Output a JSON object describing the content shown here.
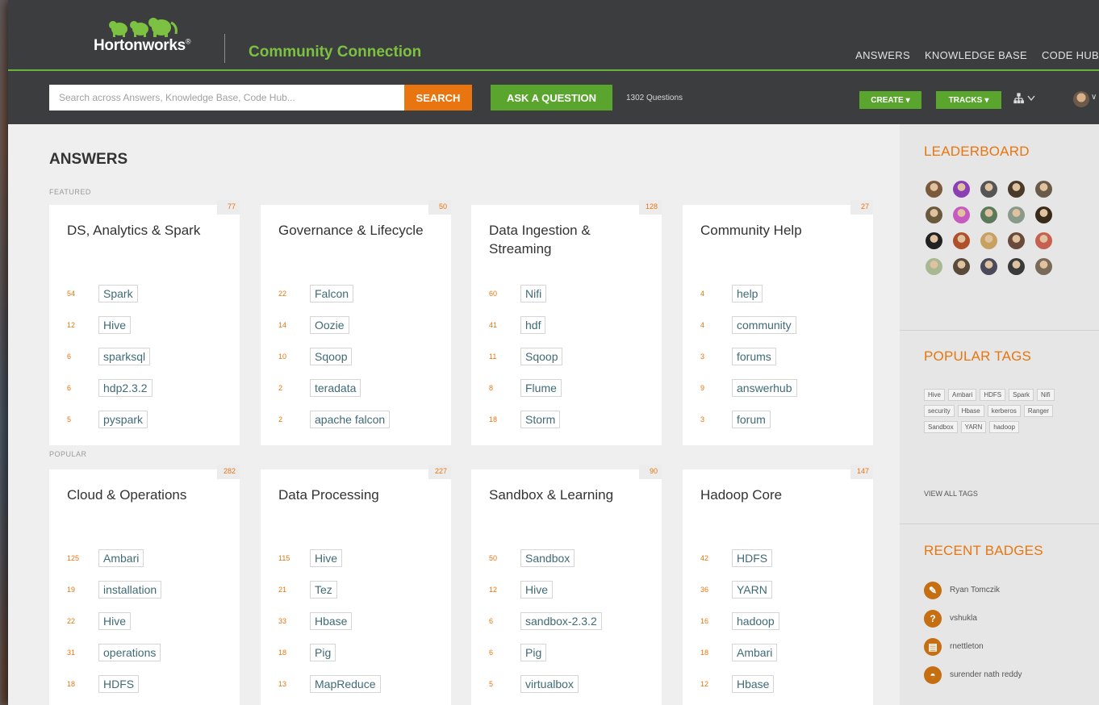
{
  "header": {
    "logo_text": "Hortonworks",
    "logo_reg": "®",
    "site_name": "Community Connection",
    "nav": [
      "ANSWERS",
      "KNOWLEDGE BASE",
      "CODE HUB"
    ]
  },
  "toolbar": {
    "search_placeholder": "Search across Answers, Knowledge Base, Code Hub...",
    "search_label": "SEARCH",
    "ask_label": "ASK A QUESTION",
    "question_count": "1302 Questions",
    "create_label": "CREATE",
    "tracks_label": "TRACKS"
  },
  "main": {
    "title": "ANSWERS",
    "featured_label": "FEATURED",
    "popular_label": "POPULAR",
    "featured": [
      {
        "title": "DS, Analytics & Spark",
        "count": "77",
        "tags": [
          {
            "num": "54",
            "name": "Spark"
          },
          {
            "num": "12",
            "name": "Hive"
          },
          {
            "num": "6",
            "name": "sparksql"
          },
          {
            "num": "6",
            "name": "hdp2.3.2"
          },
          {
            "num": "5",
            "name": "pyspark"
          }
        ]
      },
      {
        "title": "Governance & Lifecycle",
        "count": "50",
        "tags": [
          {
            "num": "22",
            "name": "Falcon"
          },
          {
            "num": "14",
            "name": "Oozie"
          },
          {
            "num": "10",
            "name": "Sqoop"
          },
          {
            "num": "2",
            "name": "teradata"
          },
          {
            "num": "2",
            "name": "apache falcon"
          }
        ]
      },
      {
        "title": "Data Ingestion & Streaming",
        "count": "128",
        "tags": [
          {
            "num": "60",
            "name": "Nifi"
          },
          {
            "num": "41",
            "name": "hdf"
          },
          {
            "num": "11",
            "name": "Sqoop"
          },
          {
            "num": "8",
            "name": "Flume"
          },
          {
            "num": "18",
            "name": "Storm"
          }
        ]
      },
      {
        "title": "Community Help",
        "count": "27",
        "tags": [
          {
            "num": "4",
            "name": "help"
          },
          {
            "num": "4",
            "name": "community"
          },
          {
            "num": "3",
            "name": "forums"
          },
          {
            "num": "9",
            "name": "answerhub"
          },
          {
            "num": "3",
            "name": "forum"
          }
        ]
      }
    ],
    "popular": [
      {
        "title": "Cloud & Operations",
        "count": "282",
        "tags": [
          {
            "num": "125",
            "name": "Ambari"
          },
          {
            "num": "19",
            "name": "installation"
          },
          {
            "num": "22",
            "name": "Hive"
          },
          {
            "num": "31",
            "name": "operations"
          },
          {
            "num": "18",
            "name": "HDFS"
          }
        ]
      },
      {
        "title": "Data Processing",
        "count": "227",
        "tags": [
          {
            "num": "115",
            "name": "Hive"
          },
          {
            "num": "21",
            "name": "Tez"
          },
          {
            "num": "33",
            "name": "Hbase"
          },
          {
            "num": "18",
            "name": "Pig"
          },
          {
            "num": "13",
            "name": "MapReduce"
          }
        ]
      },
      {
        "title": "Sandbox & Learning",
        "count": "90",
        "tags": [
          {
            "num": "50",
            "name": "Sandbox"
          },
          {
            "num": "12",
            "name": "Hive"
          },
          {
            "num": "6",
            "name": "sandbox-2.3.2"
          },
          {
            "num": "6",
            "name": "Pig"
          },
          {
            "num": "5",
            "name": "virtualbox"
          }
        ]
      },
      {
        "title": "Hadoop Core",
        "count": "147",
        "tags": [
          {
            "num": "42",
            "name": "HDFS"
          },
          {
            "num": "36",
            "name": "YARN"
          },
          {
            "num": "16",
            "name": "hadoop"
          },
          {
            "num": "18",
            "name": "Ambari"
          },
          {
            "num": "12",
            "name": "Hbase"
          }
        ]
      }
    ]
  },
  "sidebar": {
    "leaderboard_title": "LEADERBOARD",
    "leaderboard_colors": [
      "#7a5a3a",
      "#8a3fb5",
      "#555555",
      "#4a3a2a",
      "#6a5a4a",
      "#6a5a3c",
      "#c65ac0",
      "#5a7a5a",
      "#8a9a8a",
      "#3a2a1a",
      "#222222",
      "#b0502a",
      "#c8a060",
      "#6a4a3a",
      "#c66050",
      "#a8b890",
      "#5a4a3a",
      "#4a4a5a",
      "#3a3a3a",
      "#7a6a5a"
    ],
    "popular_tags_title": "POPULAR TAGS",
    "popular_tags": [
      "Hive",
      "Ambari",
      "HDFS",
      "Spark",
      "Nifi",
      "security",
      "Hbase",
      "kerberos",
      "Ranger",
      "Sandbox",
      "YARN",
      "hadoop"
    ],
    "view_all_label": "VIEW ALL TAGS",
    "recent_badges_title": "RECENT BADGES",
    "badges": [
      {
        "icon": "edit-badge-icon",
        "glyph": "✎",
        "name": "Ryan Tomczik"
      },
      {
        "icon": "question-badge-icon",
        "glyph": "?",
        "name": "vshukla"
      },
      {
        "icon": "book-badge-icon",
        "glyph": "▤",
        "name": "rnettleton"
      },
      {
        "icon": "graduation-badge-icon",
        "glyph": "◓",
        "name": "surender nath reddy"
      }
    ]
  },
  "colors": {
    "accent_green": "#5aa52d",
    "accent_orange": "#e8750f",
    "header_bg": "#3b3d3f"
  }
}
